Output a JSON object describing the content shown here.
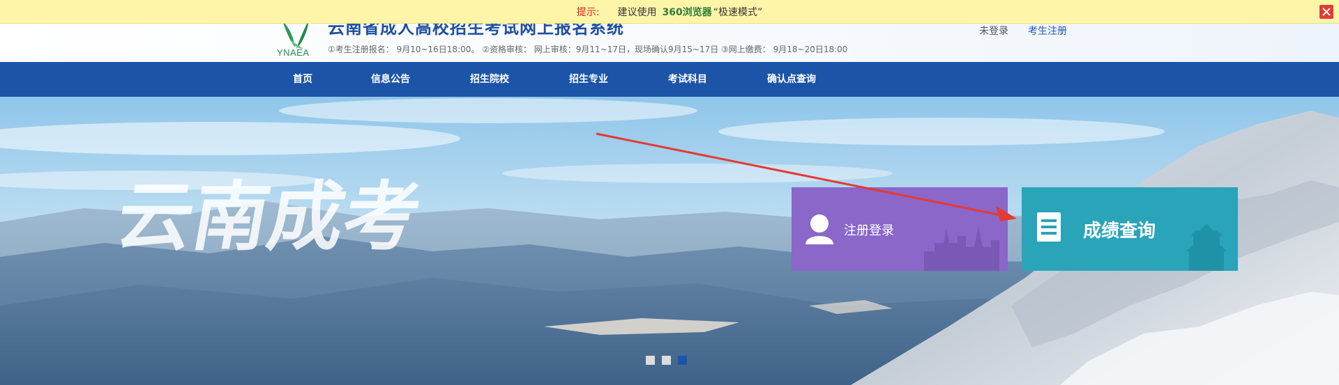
{
  "tipbar": {
    "label": "提示:",
    "pre": "建议使用",
    "brand": "360浏览器",
    "mode": "“极速模式”"
  },
  "header": {
    "logo_text": "YNAEA",
    "title": "云南省成人高校招生考试网上报名系统",
    "schedule": "①考生注册报名： 9月10~16日18:00。 ②资格审核： 网上审核：9月11~17日，现场确认9月15~17日 ③网上缴费： 9月18~20日18:00",
    "login_status": "未登录",
    "register": "考生注册"
  },
  "nav": {
    "items": [
      "首页",
      "信息公告",
      "招生院校",
      "招生专业",
      "考试科目",
      "确认点查询"
    ]
  },
  "banner": {
    "slogan": "云南成考",
    "login_tile": "注册登录",
    "score_tile": "成绩查询",
    "slides": 3,
    "active_slide": 3
  },
  "colors": {
    "nav": "#1c55a8",
    "login_tile": "#8a67c9",
    "score_tile": "#2aa4b9",
    "annotation_arrow": "#e53935"
  }
}
